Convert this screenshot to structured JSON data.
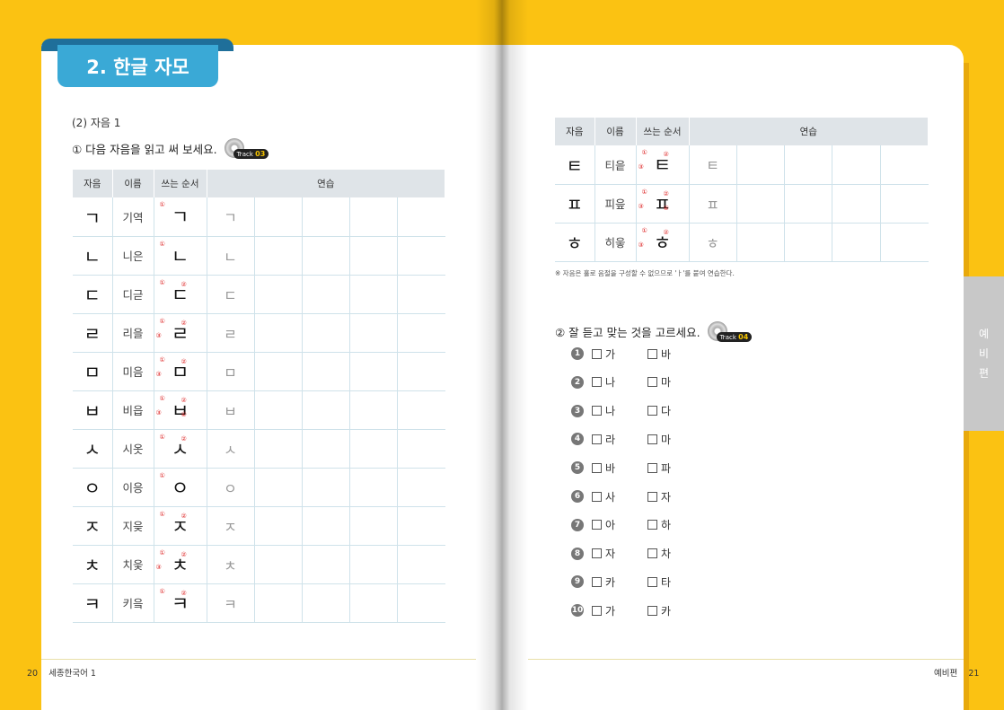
{
  "left_page": {
    "title": "2. 한글 자모",
    "subhead": "(2) 자음 1",
    "instruction": "① 다음 자음을 읽고 써 보세요.",
    "track": {
      "label": "Track",
      "number": "03"
    },
    "table_headers": [
      "자음",
      "이름",
      "쓰는 순서",
      "연습"
    ],
    "rows": [
      {
        "jamo": "ㄱ",
        "name": "기역",
        "marks": [
          "①"
        ]
      },
      {
        "jamo": "ㄴ",
        "name": "니은",
        "marks": [
          "①"
        ]
      },
      {
        "jamo": "ㄷ",
        "name": "디귿",
        "marks": [
          "①",
          "②"
        ]
      },
      {
        "jamo": "ㄹ",
        "name": "리을",
        "marks": [
          "①",
          "②",
          "③"
        ]
      },
      {
        "jamo": "ㅁ",
        "name": "미음",
        "marks": [
          "①",
          "②",
          "③"
        ]
      },
      {
        "jamo": "ㅂ",
        "name": "비읍",
        "marks": [
          "①",
          "②",
          "③",
          "④"
        ]
      },
      {
        "jamo": "ㅅ",
        "name": "시옷",
        "marks": [
          "①",
          "②"
        ]
      },
      {
        "jamo": "ㅇ",
        "name": "이응",
        "marks": [
          "①"
        ]
      },
      {
        "jamo": "ㅈ",
        "name": "지읒",
        "marks": [
          "①",
          "②"
        ]
      },
      {
        "jamo": "ㅊ",
        "name": "치읓",
        "marks": [
          "①",
          "②",
          "③"
        ]
      },
      {
        "jamo": "ㅋ",
        "name": "키읔",
        "marks": [
          "①",
          "②"
        ]
      }
    ],
    "footer": {
      "page_number": "20",
      "book_title": "세종한국어 1"
    }
  },
  "right_page": {
    "table_headers": [
      "자음",
      "이름",
      "쓰는 순서",
      "연습"
    ],
    "rows": [
      {
        "jamo": "ㅌ",
        "name": "티읕",
        "marks": [
          "①",
          "②",
          "③"
        ]
      },
      {
        "jamo": "ㅍ",
        "name": "피읖",
        "marks": [
          "①",
          "②",
          "③",
          "④"
        ]
      },
      {
        "jamo": "ㅎ",
        "name": "히읗",
        "marks": [
          "①",
          "②",
          "③"
        ]
      }
    ],
    "note": "※ 자음은 홀로 음절을 구성할 수 없으므로 'ㅏ'를 붙여 연습한다.",
    "instruction": "② 잘 듣고 맞는 것을 고르세요.",
    "track": {
      "label": "Track",
      "number": "04"
    },
    "quiz": [
      {
        "num": "1",
        "a": "가",
        "b": "바"
      },
      {
        "num": "2",
        "a": "나",
        "b": "마"
      },
      {
        "num": "3",
        "a": "나",
        "b": "다"
      },
      {
        "num": "4",
        "a": "라",
        "b": "마"
      },
      {
        "num": "5",
        "a": "바",
        "b": "파"
      },
      {
        "num": "6",
        "a": "사",
        "b": "자"
      },
      {
        "num": "7",
        "a": "아",
        "b": "하"
      },
      {
        "num": "8",
        "a": "자",
        "b": "차"
      },
      {
        "num": "9",
        "a": "카",
        "b": "타"
      },
      {
        "num": "10",
        "a": "가",
        "b": "카"
      }
    ],
    "side_tab": [
      "예",
      "비",
      "편"
    ],
    "footer": {
      "section": "예비편",
      "page_number": "21"
    }
  },
  "colors": {
    "background": "#fbc212",
    "title_tab": "#3aa9d6",
    "table_header": "#dfe4e8",
    "stroke_marks": "#dd2222"
  }
}
